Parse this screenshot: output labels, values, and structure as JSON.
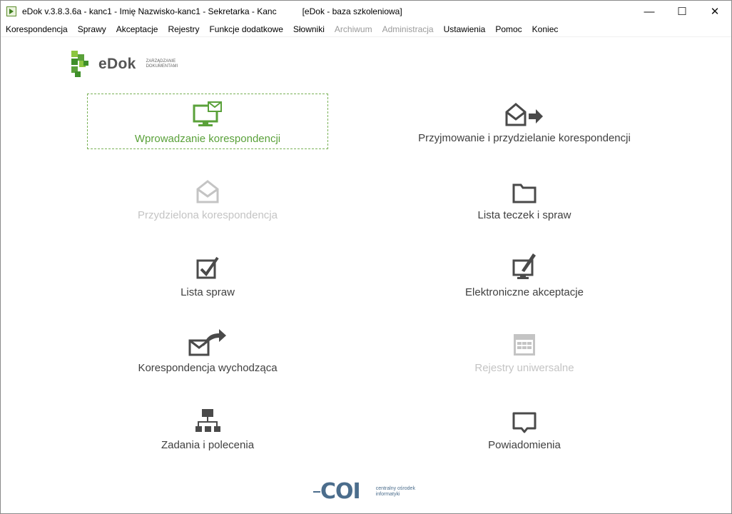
{
  "window": {
    "title": "eDok v.3.8.3.6a - kanc1 - Imię Nazwisko-kanc1 - Sekretarka - Kanc",
    "database": "[eDok - baza szkoleniowa]",
    "controls": {
      "minimize": "—",
      "maximize": "☐",
      "close": "✕"
    }
  },
  "menu": [
    {
      "label": "Korespondencja",
      "enabled": true
    },
    {
      "label": "Sprawy",
      "enabled": true
    },
    {
      "label": "Akceptacje",
      "enabled": true
    },
    {
      "label": "Rejestry",
      "enabled": true
    },
    {
      "label": "Funkcje dodatkowe",
      "enabled": true
    },
    {
      "label": "Słowniki",
      "enabled": true
    },
    {
      "label": "Archiwum",
      "enabled": false
    },
    {
      "label": "Administracja",
      "enabled": false
    },
    {
      "label": "Ustawienia",
      "enabled": true
    },
    {
      "label": "Pomoc",
      "enabled": true
    },
    {
      "label": "Koniec",
      "enabled": true
    }
  ],
  "logo": {
    "name": "eDok",
    "tagline": "ZARZĄDZANIE DOKUMENTAMI"
  },
  "tiles": [
    {
      "label": "Wprowadzanie korespondencji",
      "icon": "monitor-mail-icon",
      "state": "selected"
    },
    {
      "label": "Przyjmowanie i przydzielanie korespondencji",
      "icon": "envelope-forward-icon",
      "state": "enabled"
    },
    {
      "label": "Przydzielona korespondencja",
      "icon": "open-envelope-icon",
      "state": "disabled"
    },
    {
      "label": "Lista teczek i spraw",
      "icon": "folder-icon",
      "state": "enabled"
    },
    {
      "label": "Lista spraw",
      "icon": "checkbox-icon",
      "state": "enabled"
    },
    {
      "label": "Elektroniczne akceptacje",
      "icon": "monitor-pen-icon",
      "state": "enabled"
    },
    {
      "label": "Korespondencja wychodząca",
      "icon": "envelope-send-icon",
      "state": "enabled"
    },
    {
      "label": "Rejestry uniwersalne",
      "icon": "calendar-grid-icon",
      "state": "disabled"
    },
    {
      "label": "Zadania i polecenia",
      "icon": "org-chart-icon",
      "state": "enabled"
    },
    {
      "label": "Powiadomienia",
      "icon": "speech-bubble-icon",
      "state": "enabled"
    }
  ],
  "footer": {
    "logo_text": "COI",
    "tagline": "centralny ośrodek informatyki"
  },
  "colors": {
    "accent": "#5aa13a",
    "icon": "#4a4a4a",
    "disabled": "#c4c4c4",
    "coi": "#4b6d8c"
  }
}
